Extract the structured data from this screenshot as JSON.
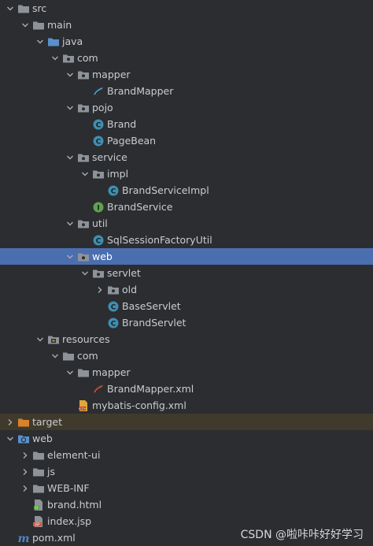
{
  "tree": [
    {
      "name": "tree-src",
      "label": "src",
      "depth": 0,
      "icon": "folder-icon",
      "chevron": "down"
    },
    {
      "name": "tree-main",
      "label": "main",
      "depth": 1,
      "icon": "folder-icon",
      "chevron": "down"
    },
    {
      "name": "tree-java",
      "label": "java",
      "depth": 2,
      "icon": "source-folder-icon",
      "chevron": "down"
    },
    {
      "name": "tree-com",
      "label": "com",
      "depth": 3,
      "icon": "package-icon",
      "chevron": "down"
    },
    {
      "name": "tree-mapper",
      "label": "mapper",
      "depth": 4,
      "icon": "package-icon",
      "chevron": "down"
    },
    {
      "name": "tree-brandmapper",
      "label": "BrandMapper",
      "depth": 5,
      "icon": "mybatis-mapper-icon",
      "chevron": "none"
    },
    {
      "name": "tree-pojo",
      "label": "pojo",
      "depth": 4,
      "icon": "package-icon",
      "chevron": "down"
    },
    {
      "name": "tree-brand",
      "label": "Brand",
      "depth": 5,
      "icon": "class-icon",
      "chevron": "none"
    },
    {
      "name": "tree-pagebean",
      "label": "PageBean",
      "depth": 5,
      "icon": "class-icon",
      "chevron": "none"
    },
    {
      "name": "tree-service",
      "label": "service",
      "depth": 4,
      "icon": "package-icon",
      "chevron": "down"
    },
    {
      "name": "tree-impl",
      "label": "impl",
      "depth": 5,
      "icon": "package-icon",
      "chevron": "down"
    },
    {
      "name": "tree-brandserviceimpl",
      "label": "BrandServiceImpl",
      "depth": 6,
      "icon": "class-icon",
      "chevron": "none"
    },
    {
      "name": "tree-brandservice",
      "label": "BrandService",
      "depth": 5,
      "icon": "interface-icon",
      "chevron": "none"
    },
    {
      "name": "tree-util",
      "label": "util",
      "depth": 4,
      "icon": "package-icon",
      "chevron": "down"
    },
    {
      "name": "tree-sqlsessionfactoryutil",
      "label": "SqlSessionFactoryUtil",
      "depth": 5,
      "icon": "class-icon",
      "chevron": "none"
    },
    {
      "name": "tree-web",
      "label": "web",
      "depth": 4,
      "icon": "package-icon",
      "chevron": "down",
      "selected": true
    },
    {
      "name": "tree-servlet",
      "label": "servlet",
      "depth": 5,
      "icon": "package-icon",
      "chevron": "down"
    },
    {
      "name": "tree-old",
      "label": "old",
      "depth": 6,
      "icon": "package-icon",
      "chevron": "right"
    },
    {
      "name": "tree-baseservlet",
      "label": "BaseServlet",
      "depth": 6,
      "icon": "class-icon",
      "chevron": "none"
    },
    {
      "name": "tree-brandservlet",
      "label": "BrandServlet",
      "depth": 6,
      "icon": "class-icon",
      "chevron": "none"
    },
    {
      "name": "tree-resources",
      "label": "resources",
      "depth": 2,
      "icon": "resources-folder-icon",
      "chevron": "down"
    },
    {
      "name": "tree-res-com",
      "label": "com",
      "depth": 3,
      "icon": "folder-icon",
      "chevron": "down"
    },
    {
      "name": "tree-res-mapper",
      "label": "mapper",
      "depth": 4,
      "icon": "folder-icon",
      "chevron": "down"
    },
    {
      "name": "tree-brandmapper-xml",
      "label": "BrandMapper.xml",
      "depth": 5,
      "icon": "mybatis-xml-icon",
      "chevron": "none"
    },
    {
      "name": "tree-mybatis-config",
      "label": "mybatis-config.xml",
      "depth": 4,
      "icon": "xml-file-icon",
      "chevron": "none"
    },
    {
      "name": "tree-target",
      "label": "target",
      "depth": 0,
      "icon": "excluded-folder-icon",
      "chevron": "right",
      "excluded": true
    },
    {
      "name": "tree-web-root",
      "label": "web",
      "depth": 0,
      "icon": "web-folder-icon",
      "chevron": "down"
    },
    {
      "name": "tree-element-ui",
      "label": "element-ui",
      "depth": 1,
      "icon": "folder-icon",
      "chevron": "right"
    },
    {
      "name": "tree-js",
      "label": "js",
      "depth": 1,
      "icon": "folder-icon",
      "chevron": "right"
    },
    {
      "name": "tree-web-inf",
      "label": "WEB-INF",
      "depth": 1,
      "icon": "folder-icon",
      "chevron": "right"
    },
    {
      "name": "tree-brand-html",
      "label": "brand.html",
      "depth": 1,
      "icon": "html-file-icon",
      "chevron": "none"
    },
    {
      "name": "tree-index-jsp",
      "label": "index.jsp",
      "depth": 1,
      "icon": "jsp-file-icon",
      "chevron": "none"
    },
    {
      "name": "tree-pom-xml",
      "label": "pom.xml",
      "depth": 0,
      "icon": "maven-icon",
      "chevron": "none"
    }
  ],
  "watermark": "CSDN @啦咔咔好好学习",
  "colors": {
    "background": "#2b2d30",
    "selection": "#4b6eaf",
    "excluded_row": "#3f3a2c",
    "class_icon": "#3e8fb0",
    "interface_icon": "#5ea34c",
    "folder_icon": "#8e9399",
    "source_folder_icon": "#5a8fcb",
    "excluded_folder_icon": "#d9822b"
  }
}
